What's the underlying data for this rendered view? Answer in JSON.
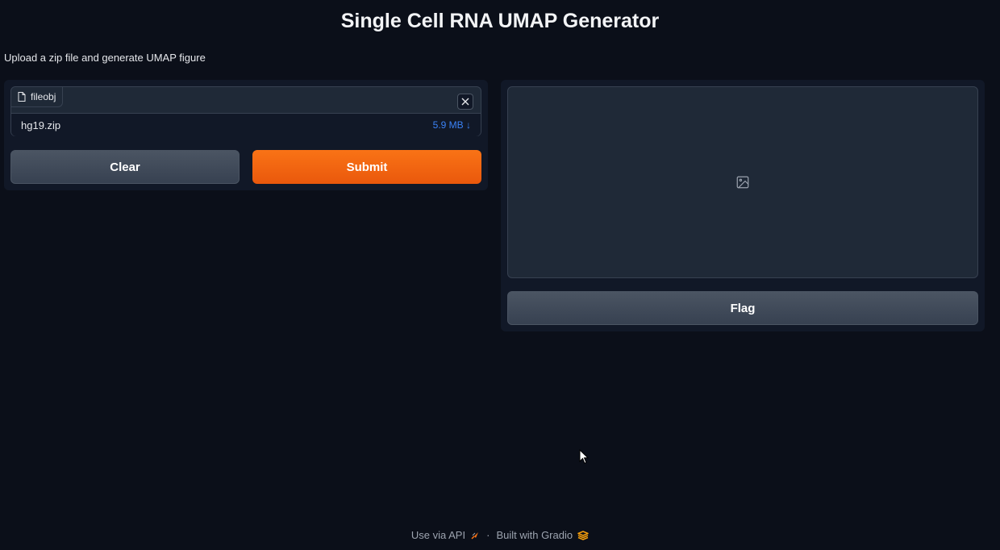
{
  "header": {
    "title": "Single Cell RNA UMAP Generator",
    "description": "Upload a zip file and generate UMAP figure"
  },
  "input_panel": {
    "file_label": "fileobj",
    "file_name": "hg19.zip",
    "file_size": "5.9 MB ↓",
    "clear_label": "Clear",
    "submit_label": "Submit"
  },
  "output_panel": {
    "flag_label": "Flag"
  },
  "footer": {
    "api_label": "Use via API",
    "separator": "·",
    "built_label": "Built with Gradio"
  },
  "colors": {
    "background": "#0b0f19",
    "panel": "#111827",
    "primary": "#f97316",
    "secondary": "#4b5563",
    "link": "#3b82f6"
  }
}
